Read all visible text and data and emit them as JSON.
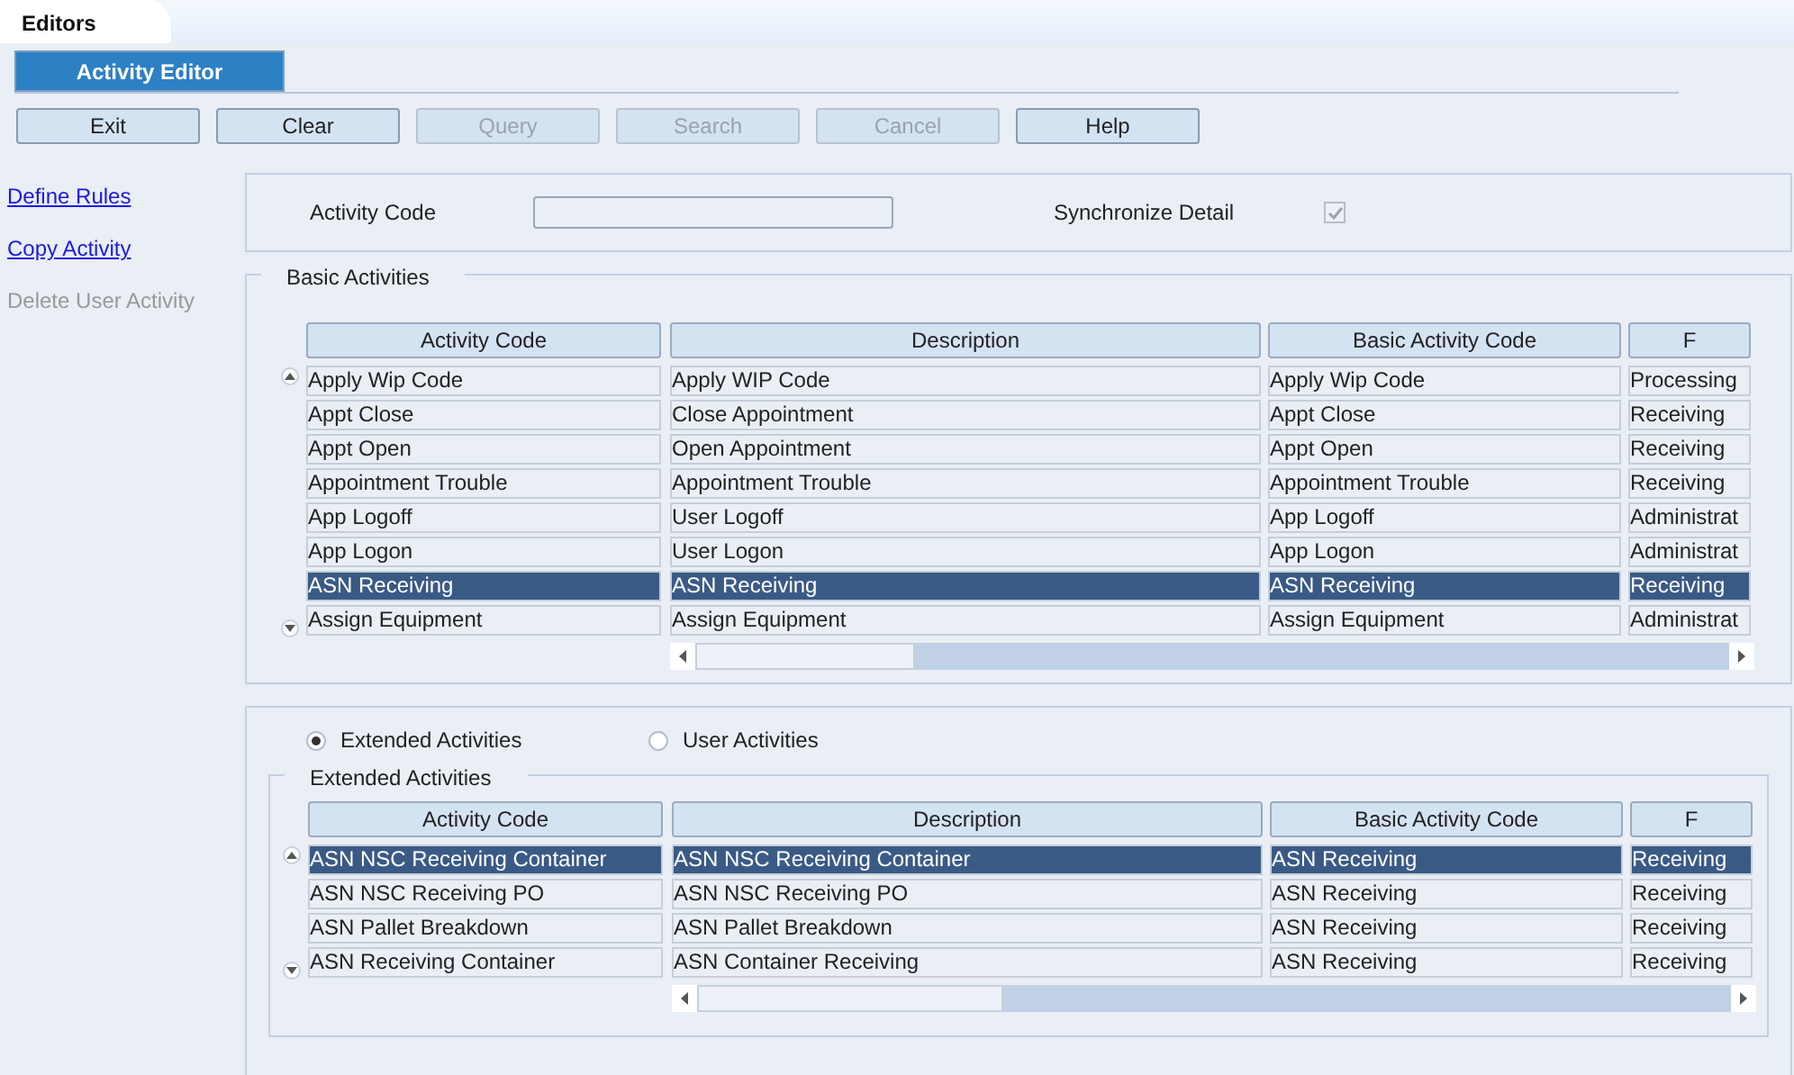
{
  "top_tab": "Editors",
  "page_tab": {
    "label": "Activity Editor",
    "selected": true
  },
  "toolbar": [
    {
      "label": "Exit",
      "disabled": false
    },
    {
      "label": "Clear",
      "disabled": false
    },
    {
      "label": "Query",
      "disabled": true
    },
    {
      "label": "Search",
      "disabled": true
    },
    {
      "label": "Cancel",
      "disabled": true
    },
    {
      "label": "Help",
      "disabled": false
    }
  ],
  "side_links": [
    {
      "label": "Define Rules",
      "disabled": false
    },
    {
      "label": "Copy Activity",
      "disabled": false
    },
    {
      "label": "Delete User Activity",
      "disabled": true
    }
  ],
  "query": {
    "activity_code_label": "Activity Code",
    "sync_label": "Synchronize Detail",
    "sync_checked": true
  },
  "basic": {
    "title": "Basic Activities",
    "columns": [
      "Activity Code",
      "Description",
      "Basic Activity Code",
      "F"
    ],
    "rows": [
      {
        "cells": [
          "Apply Wip Code",
          "Apply WIP Code",
          "Apply Wip Code",
          "Processing"
        ],
        "selected": false
      },
      {
        "cells": [
          "Appt Close",
          "Close Appointment",
          "Appt Close",
          "Receiving"
        ],
        "selected": false
      },
      {
        "cells": [
          "Appt Open",
          "Open Appointment",
          "Appt Open",
          "Receiving"
        ],
        "selected": false
      },
      {
        "cells": [
          "Appointment Trouble",
          "Appointment Trouble",
          "Appointment Trouble",
          "Receiving"
        ],
        "selected": false
      },
      {
        "cells": [
          "App Logoff",
          "User Logoff",
          "App Logoff",
          "Administrat"
        ],
        "selected": false
      },
      {
        "cells": [
          "App Logon",
          "User Logon",
          "App Logon",
          "Administrat"
        ],
        "selected": false
      },
      {
        "cells": [
          "ASN Receiving",
          "ASN Receiving",
          "ASN Receiving",
          "Receiving"
        ],
        "selected": true
      },
      {
        "cells": [
          "Assign Equipment",
          "Assign Equipment",
          "Assign Equipment",
          "Administrat"
        ],
        "selected": false
      }
    ]
  },
  "radios": [
    {
      "label": "Extended Activities",
      "selected": true
    },
    {
      "label": "User Activities",
      "selected": false
    }
  ],
  "extended": {
    "title": "Extended Activities",
    "columns": [
      "Activity Code",
      "Description",
      "Basic Activity Code",
      "F"
    ],
    "rows": [
      {
        "cells": [
          "ASN NSC Receiving Container",
          "ASN NSC Receiving Container",
          "ASN Receiving",
          "Receiving"
        ],
        "selected": true
      },
      {
        "cells": [
          "ASN NSC Receiving PO",
          "ASN NSC Receiving PO",
          "ASN Receiving",
          "Receiving"
        ],
        "selected": false
      },
      {
        "cells": [
          "ASN Pallet Breakdown",
          "ASN Pallet Breakdown",
          "ASN Receiving",
          "Receiving"
        ],
        "selected": false
      },
      {
        "cells": [
          "ASN Receiving Container",
          "ASN Container Receiving",
          "ASN Receiving",
          "Receiving"
        ],
        "selected": false
      }
    ]
  }
}
